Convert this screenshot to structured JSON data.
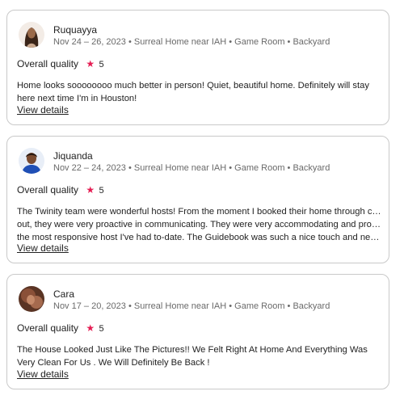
{
  "reviews": [
    {
      "name": "Ruquayya",
      "meta": "Nov 24 – 26, 2023 • Surreal Home near IAH • Game Room • Backyard",
      "quality_label": "Overall quality",
      "rating": "5",
      "text": "Home looks soooooooo much better in person! Quiet, beautiful home. Definitely will stay here next time I'm in Houston!",
      "view_details": "View details",
      "avatar_color": "#7a4a2e"
    },
    {
      "name": "Jiquanda",
      "meta": "Nov 22 – 24, 2023 • Surreal Home near IAH • Game Room • Backyard",
      "quality_label": "Overall quality",
      "rating": "5",
      "text_lines": [
        "The Twinity team were wonderful hosts! From the moment I booked their home through check",
        "out, they were very proactive in communicating. They were very accommodating and probably",
        "the most responsive host I've had to-date. The Guidebook was such a nice touch and next le..."
      ],
      "view_details": "View details",
      "avatar_color": "#1f4fb5"
    },
    {
      "name": "Cara",
      "meta": "Nov 17 – 20, 2023 • Surreal Home near IAH • Game Room • Backyard",
      "quality_label": "Overall quality",
      "rating": "5",
      "text": "The House Looked Just Like The Pictures!! We Felt Right At Home And Everything Was Very Clean For Us . We Will Definitely Be Back !",
      "view_details": "View details",
      "avatar_color": "#6b3a28"
    }
  ],
  "accent_star_color": "#e51d53"
}
